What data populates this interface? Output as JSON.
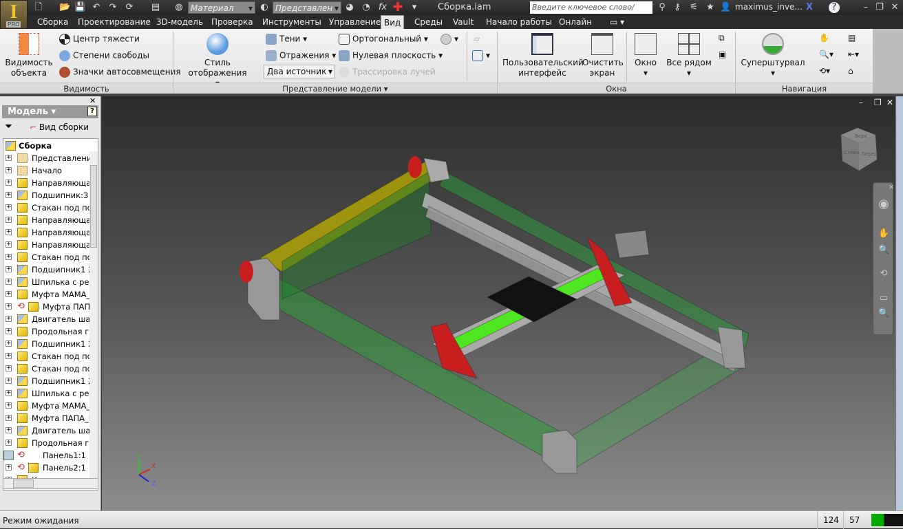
{
  "titlebar": {
    "material_placeholder": "Материал",
    "representation_placeholder": "Представлен",
    "document_title": "Сборка.iam",
    "search_placeholder": "Введите ключевое слово/фразу",
    "user": "maximus_inve...",
    "logo_badge": "PRO"
  },
  "tabs": [
    "Сборка",
    "Проектирование",
    "3D-модель",
    "Проверка",
    "Инструменты",
    "Управление",
    "Вид",
    "Среды",
    "Vault",
    "Начало работы",
    "Онлайн"
  ],
  "active_tab": "Вид",
  "ribbon": {
    "visibility": {
      "label": "Видимость",
      "object_visibility": "Видимость объекта",
      "center_of_gravity": "Центр тяжести",
      "degrees_of_freedom": "Степени свободы",
      "autolimit_glyphs": "Значки автосовмещения"
    },
    "model_view": {
      "label": "Представление модели",
      "visual_style": "Стиль отображения",
      "shadows": "Тени",
      "reflections": "Отражения",
      "lighting": "Два источник",
      "orthographic": "Ортогональный",
      "ground_plane": "Нулевая плоскость",
      "ray_tracing": "Трассировка лучей"
    },
    "windows": {
      "label": "Окна",
      "user_interface": "Пользовательский интерфейс",
      "clean_screen": "Очистить экран",
      "window": "Окно",
      "tile": "Все рядом"
    },
    "navigation": {
      "label": "Навигация",
      "steering_wheel": "Суперштурвал"
    }
  },
  "browser": {
    "title": "Модель",
    "view_mode": "Вид сборки",
    "root": "Сборка",
    "items": [
      {
        "label": "Представления",
        "icon": "representations"
      },
      {
        "label": "Начало",
        "icon": "folder"
      },
      {
        "label": "Направляющая",
        "icon": "part"
      },
      {
        "label": "Подшипник:3",
        "icon": "assembly"
      },
      {
        "label": "Стакан под под",
        "icon": "part"
      },
      {
        "label": "Направляющая",
        "icon": "part"
      },
      {
        "label": "Направляющая",
        "icon": "part"
      },
      {
        "label": "Направляющая",
        "icon": "part"
      },
      {
        "label": "Стакан под под",
        "icon": "part"
      },
      {
        "label": "Подшипник1 22",
        "icon": "assembly"
      },
      {
        "label": "Шпилька с резь",
        "icon": "assembly"
      },
      {
        "label": "Муфта МАМА_К",
        "icon": "part"
      },
      {
        "label": "Муфта ПАПА",
        "icon": "part",
        "adaptive": true
      },
      {
        "label": "Двигатель шаго",
        "icon": "assembly"
      },
      {
        "label": "Продольная гай",
        "icon": "part"
      },
      {
        "label": "Подшипник1 22",
        "icon": "assembly"
      },
      {
        "label": "Стакан под под",
        "icon": "part"
      },
      {
        "label": "Стакан под под",
        "icon": "part"
      },
      {
        "label": "Подшипник1 22",
        "icon": "assembly"
      },
      {
        "label": "Шпилька с резь",
        "icon": "assembly"
      },
      {
        "label": "Муфта МАМА_К",
        "icon": "part"
      },
      {
        "label": "Муфта ПАПА_К",
        "icon": "part"
      },
      {
        "label": "Двигатель шаго",
        "icon": "assembly"
      },
      {
        "label": "Продольная гай",
        "icon": "part"
      },
      {
        "label": "Панель1:1",
        "icon": "sheet",
        "adaptive": true
      },
      {
        "label": "Панель2:1",
        "icon": "part",
        "adaptive": true
      },
      {
        "label": "Крыло над вин",
        "icon": "part"
      }
    ]
  },
  "viewcube": {
    "top": "Верх",
    "left": "Слева",
    "front": "Перед"
  },
  "triad": {
    "x": "X",
    "y": "Y",
    "z": "Z"
  },
  "status": {
    "text": "Режим ожидания",
    "value1": "124",
    "value2": "57"
  },
  "colors": {
    "frame_green": "#2e9a3a",
    "carriage_green": "#4ee61e",
    "bracket_red": "#c81e1e",
    "plate_black": "#111111"
  }
}
